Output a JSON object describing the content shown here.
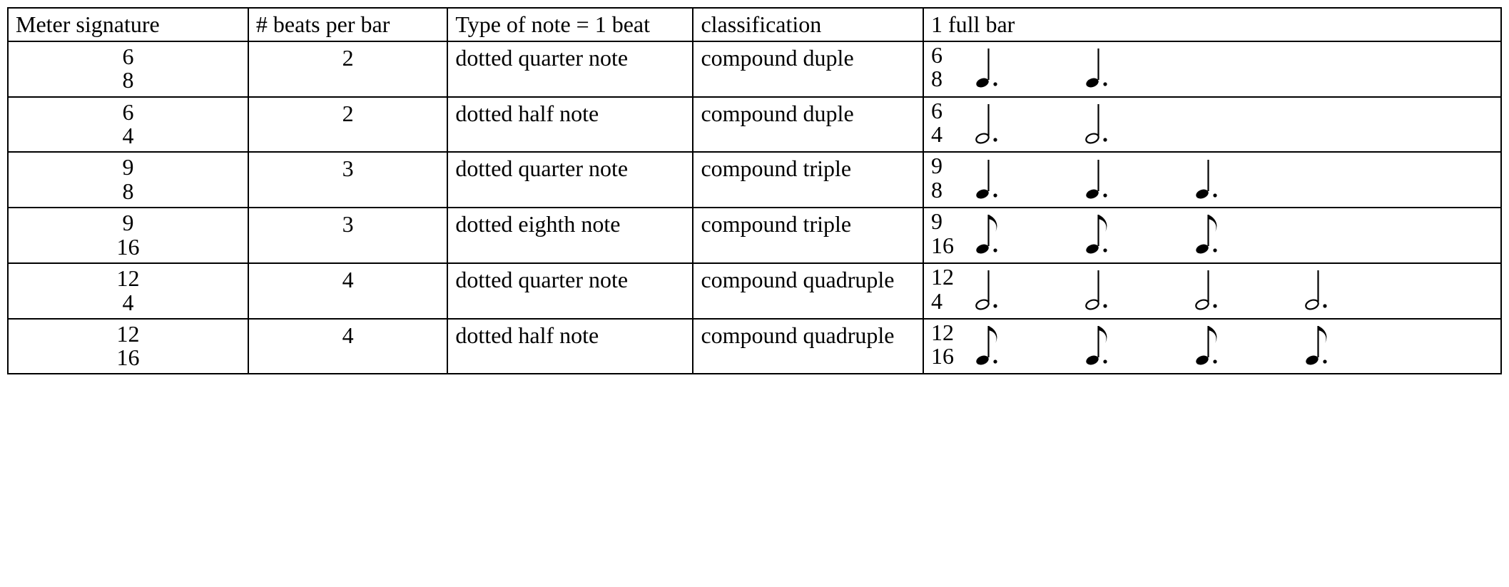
{
  "headers": {
    "meter": "Meter signature",
    "beats": "# beats per bar",
    "note_type": "Type of note = 1 beat",
    "classification": "classification",
    "full_bar": "1 full bar"
  },
  "rows": [
    {
      "meter_top": "6",
      "meter_bottom": "8",
      "beats": "2",
      "note_type": "dotted quarter note",
      "classification": "compound duple",
      "bar_top": "6",
      "bar_bottom": "8",
      "note_glyph": "quarter_dotted",
      "note_count": 2
    },
    {
      "meter_top": "6",
      "meter_bottom": "4",
      "beats": "2",
      "note_type": "dotted half note",
      "classification": "compound duple",
      "bar_top": "6",
      "bar_bottom": "4",
      "note_glyph": "half_dotted",
      "note_count": 2
    },
    {
      "meter_top": "9",
      "meter_bottom": "8",
      "beats": "3",
      "note_type": "dotted quarter note",
      "classification": "compound triple",
      "bar_top": "9",
      "bar_bottom": "8",
      "note_glyph": "quarter_dotted",
      "note_count": 3
    },
    {
      "meter_top": "9",
      "meter_bottom": "16",
      "beats": "3",
      "note_type": "dotted eighth note",
      "classification": "compound triple",
      "bar_top": "9",
      "bar_bottom": "16",
      "note_glyph": "eighth_dotted",
      "note_count": 3
    },
    {
      "meter_top": "12",
      "meter_bottom": "4",
      "beats": "4",
      "note_type": "dotted quarter note",
      "classification": "compound quadruple",
      "bar_top": "12",
      "bar_bottom": "4",
      "note_glyph": "half_dotted",
      "note_count": 4
    },
    {
      "meter_top": "12",
      "meter_bottom": "16",
      "beats": "4",
      "note_type": "dotted half note",
      "classification": "compound quadruple",
      "bar_top": "12",
      "bar_bottom": "16",
      "note_glyph": "eighth_dotted",
      "note_count": 4
    }
  ],
  "chart_data": {
    "type": "table",
    "title": "Compound meter signatures",
    "columns": [
      "Meter signature",
      "# beats per bar",
      "Type of note = 1 beat",
      "classification",
      "1 full bar"
    ],
    "rows": [
      [
        "6/8",
        2,
        "dotted quarter note",
        "compound duple",
        "6/8 with 2 dotted quarter notes"
      ],
      [
        "6/4",
        2,
        "dotted half note",
        "compound duple",
        "6/4 with 2 dotted half notes"
      ],
      [
        "9/8",
        3,
        "dotted quarter note",
        "compound triple",
        "9/8 with 3 dotted quarter notes"
      ],
      [
        "9/16",
        3,
        "dotted eighth note",
        "compound triple",
        "9/16 with 3 dotted eighth notes"
      ],
      [
        "12/4",
        4,
        "dotted quarter note",
        "compound quadruple",
        "12/4 with 4 dotted half notes"
      ],
      [
        "12/16",
        4,
        "dotted half note",
        "compound quadruple",
        "12/16 with 4 dotted eighth notes"
      ]
    ]
  }
}
